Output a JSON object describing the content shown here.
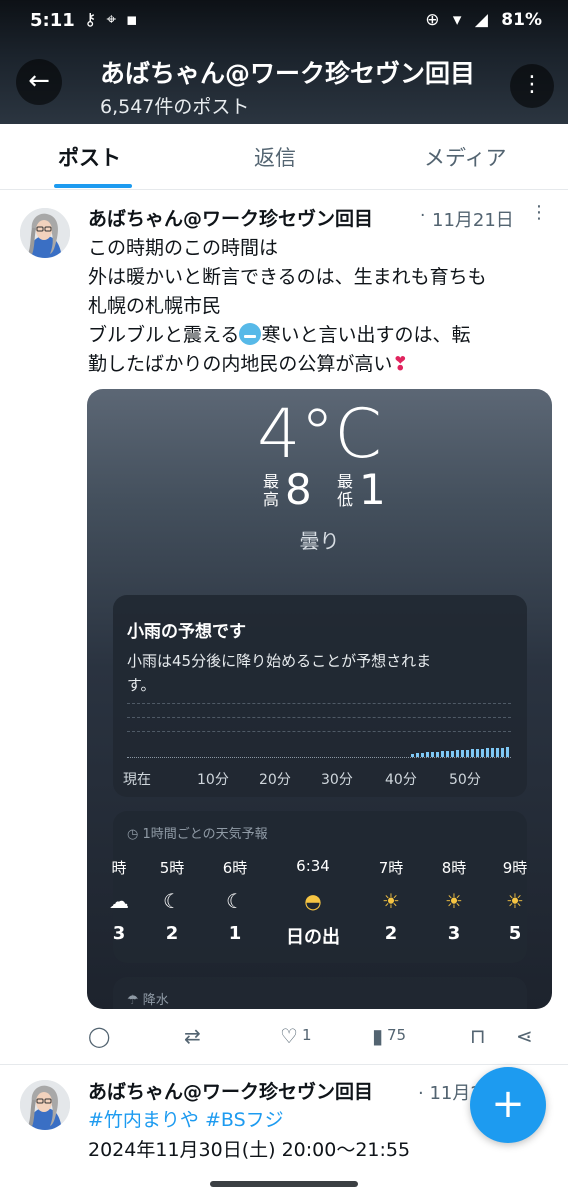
{
  "status_bar": {
    "time": "5:11",
    "left_icons": [
      "keyhole-icon",
      "location-icon",
      "message-icon"
    ],
    "battery": "81%"
  },
  "header": {
    "title": "あばちゃん@ワーク珍セヴン回目",
    "subtitle": "6,547件のポスト",
    "back_icon": "arrow-left-icon",
    "more_icon": "more-vertical-icon"
  },
  "tabs": [
    {
      "label": "ポスト",
      "active": true
    },
    {
      "label": "返信",
      "active": false
    },
    {
      "label": "メディア",
      "active": false
    }
  ],
  "tweet1": {
    "author": "あばちゃん@ワーク珍セヴン回目",
    "separator": "·",
    "date": "11月21日",
    "lines": [
      "この時期のこの時間は",
      "外は暖かいと断言できるのは、生まれも育ちも",
      "札幌の札幌市民",
      "ブルブルと震える",
      "寒いと言い出すのは、転",
      "勤したばかりの内地民の公算が高い"
    ],
    "weather": {
      "temperature": "4°C",
      "high_label": "最高",
      "high": "8",
      "low_label": "最低",
      "low": "1",
      "condition": "曇り",
      "rain_title": "小雨の予想です",
      "rain_text": "小雨は45分後に降り始めることが予想されます。",
      "rain_ticks": [
        "現在",
        "10分",
        "20分",
        "30分",
        "40分",
        "50分"
      ],
      "rain_intensity": [
        0.3,
        0.4,
        0.4,
        0.5,
        0.5,
        0.5,
        0.6,
        0.6,
        0.6,
        0.7,
        0.7,
        0.7,
        0.8,
        0.8,
        0.8,
        0.9,
        0.9,
        0.9,
        0.9,
        1.0
      ],
      "hourly_title": "1時間ごとの天気予報",
      "hourly": [
        {
          "time": "時",
          "icon": "moon-cloud-icon",
          "value": "3"
        },
        {
          "time": "5時",
          "icon": "moon-stars-icon",
          "value": "2"
        },
        {
          "time": "6時",
          "icon": "moon-stars-icon",
          "value": "1"
        },
        {
          "time": "6:34",
          "icon": "sunrise-icon",
          "value": "日の出"
        },
        {
          "time": "7時",
          "icon": "sun-icon",
          "value": "2"
        },
        {
          "time": "8時",
          "icon": "sun-icon",
          "value": "3"
        },
        {
          "time": "9時",
          "icon": "sun-cloud-icon",
          "value": "5"
        }
      ],
      "precip_title": "降水"
    },
    "actions": {
      "reply_icon": "reply-icon",
      "retweet_icon": "retweet-icon",
      "like_icon": "heart-icon",
      "likes": "1",
      "views_icon": "views-icon",
      "views": "75",
      "bookmark_icon": "bookmark-icon",
      "share_icon": "share-icon"
    }
  },
  "tweet2": {
    "author": "あばちゃん@ワーク珍セヴン回目",
    "date": "· 11月2",
    "hashtags": "#竹内まりや #BSフジ",
    "line": "2024年11月30日(土) 20:00〜21:55"
  },
  "fab": {
    "label": "+",
    "icon": "compose-plus-icon"
  }
}
